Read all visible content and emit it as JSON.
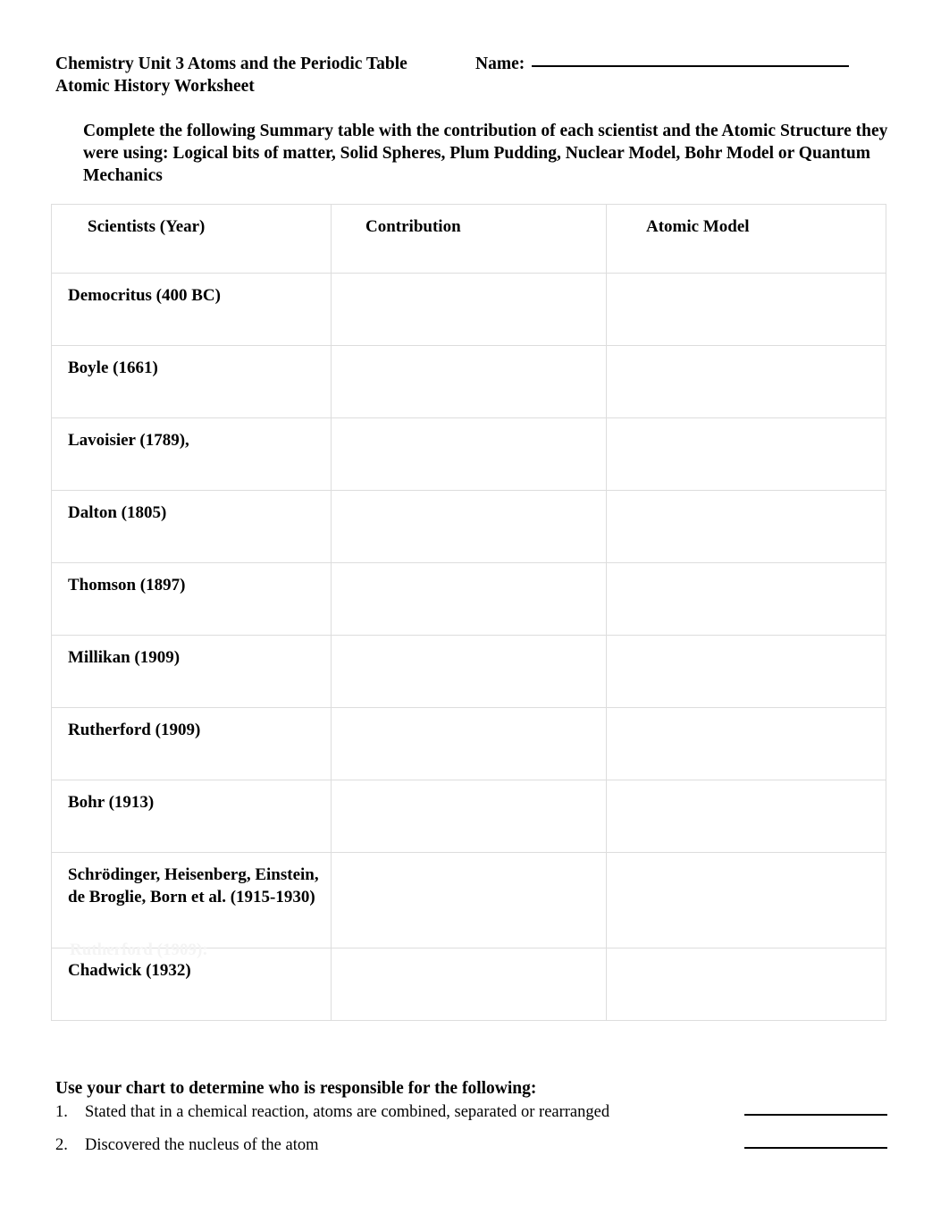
{
  "document": {
    "title_line1": "Chemistry Unit 3 Atoms and the Periodic Table",
    "title_line2": "Atomic History Worksheet",
    "name_label": "Name:",
    "name_value": "",
    "instruction": "Complete the following Summary table with the contribution of each scientist and the Atomic Structure they were using: Logical bits of matter, Solid Spheres, Plum Pudding, Nuclear Model, Bohr Model or Quantum Mechanics"
  },
  "table": {
    "headers": [
      "Scientists (Year)",
      "Contribution",
      "Atomic Model"
    ],
    "rows": [
      {
        "scientist": "Democritus (400 BC)",
        "contribution": "",
        "atomic_model": ""
      },
      {
        "scientist": "Boyle (1661)",
        "contribution": "",
        "atomic_model": ""
      },
      {
        "scientist": "Lavoisier (1789),",
        "contribution": "",
        "atomic_model": ""
      },
      {
        "scientist": "Dalton (1805)",
        "contribution": "",
        "atomic_model": ""
      },
      {
        "scientist": "Thomson (1897)",
        "contribution": "",
        "atomic_model": ""
      },
      {
        "scientist": "Millikan (1909)",
        "contribution": "",
        "atomic_model": ""
      },
      {
        "scientist": "Rutherford (1909)",
        "contribution": "",
        "atomic_model": ""
      },
      {
        "scientist": "Bohr (1913)",
        "contribution": "",
        "atomic_model": ""
      },
      {
        "scientist": "Schrödinger, Heisenberg, Einstein, de Broglie, Born et al. (1915-1930)",
        "contribution": "",
        "atomic_model": ""
      },
      {
        "scientist": "Chadwick (1932)",
        "contribution": "",
        "atomic_model": ""
      }
    ],
    "artifact_text": "Rutherford (1909):"
  },
  "questions": {
    "heading": "Use your chart to determine who is responsible for the following:",
    "items": [
      {
        "number": "1.",
        "text": "Stated that in a chemical reaction, atoms are combined, separated or rearranged",
        "answer": ""
      },
      {
        "number": "2.",
        "text": "Discovered the nucleus of the atom",
        "answer": ""
      }
    ]
  },
  "colors": {
    "text": "#000000",
    "table_border": "#dddddd",
    "rule": "#000000",
    "ghost": "#f4f4f4",
    "page_background": "#ffffff"
  }
}
